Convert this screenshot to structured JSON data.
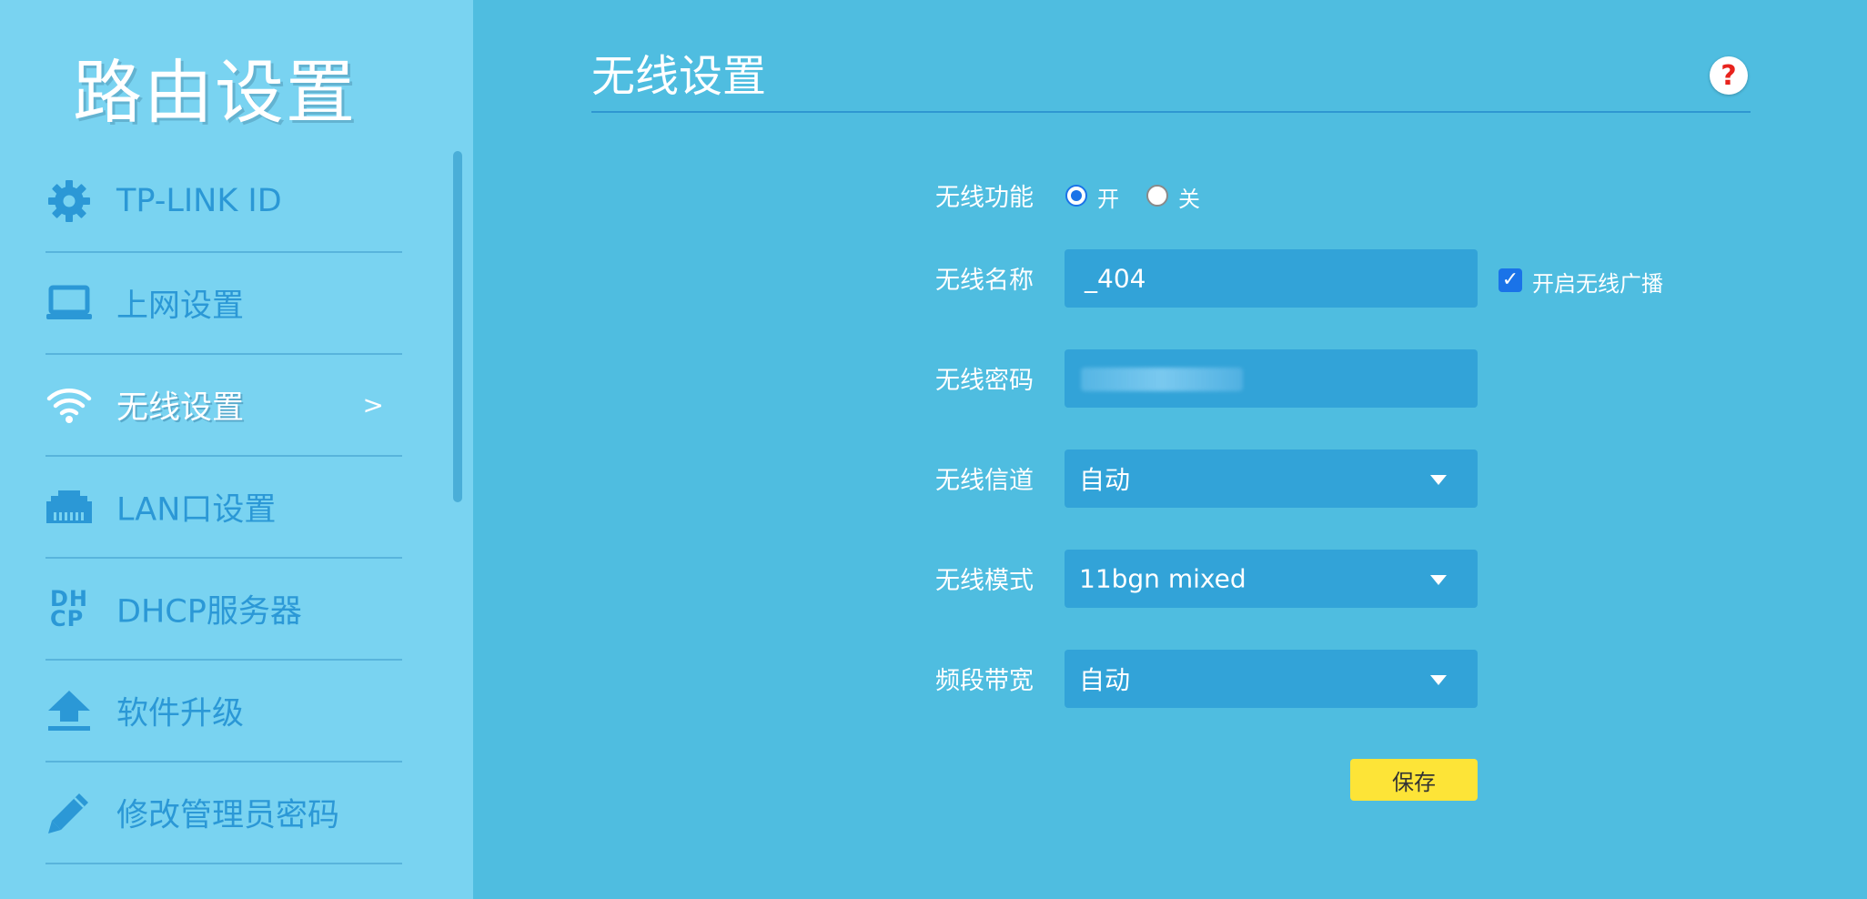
{
  "sidebar": {
    "title": "路由设置",
    "items": [
      {
        "label": "TP-LINK ID",
        "icon": "gear-icon"
      },
      {
        "label": "上网设置",
        "icon": "laptop-icon"
      },
      {
        "label": "无线设置",
        "icon": "wifi-icon",
        "arrow": ">"
      },
      {
        "label": "LAN口设置",
        "icon": "lan-port-icon"
      },
      {
        "label": "DHCP服务器",
        "icon": "dhcp-icon",
        "icon_text_top": "DH",
        "icon_text_bottom": "CP"
      },
      {
        "label": "软件升级",
        "icon": "upload-icon"
      },
      {
        "label": "修改管理员密码",
        "icon": "pencil-icon"
      }
    ]
  },
  "main": {
    "title": "无线设置",
    "help_icon": "?",
    "form": {
      "wireless_function": {
        "label": "无线功能",
        "on_label": "开",
        "off_label": "关",
        "selected": "开"
      },
      "ssid": {
        "label": "无线名称",
        "value": "_404",
        "broadcast_label": "开启无线广播",
        "broadcast_checked": true
      },
      "password": {
        "label": "无线密码"
      },
      "channel": {
        "label": "无线信道",
        "value": "自动"
      },
      "mode": {
        "label": "无线模式",
        "value": "11bgn mixed"
      },
      "bandwidth": {
        "label": "频段带宽",
        "value": "自动"
      }
    },
    "save_label": "保存"
  },
  "colors": {
    "main_bg": "#4fbde0",
    "sidebar_bg": "#79d3f1",
    "field_bg": "#32a3d8",
    "nav_text": "#2b98d6",
    "save_button": "#fde437",
    "help_mark": "#e8231d"
  }
}
